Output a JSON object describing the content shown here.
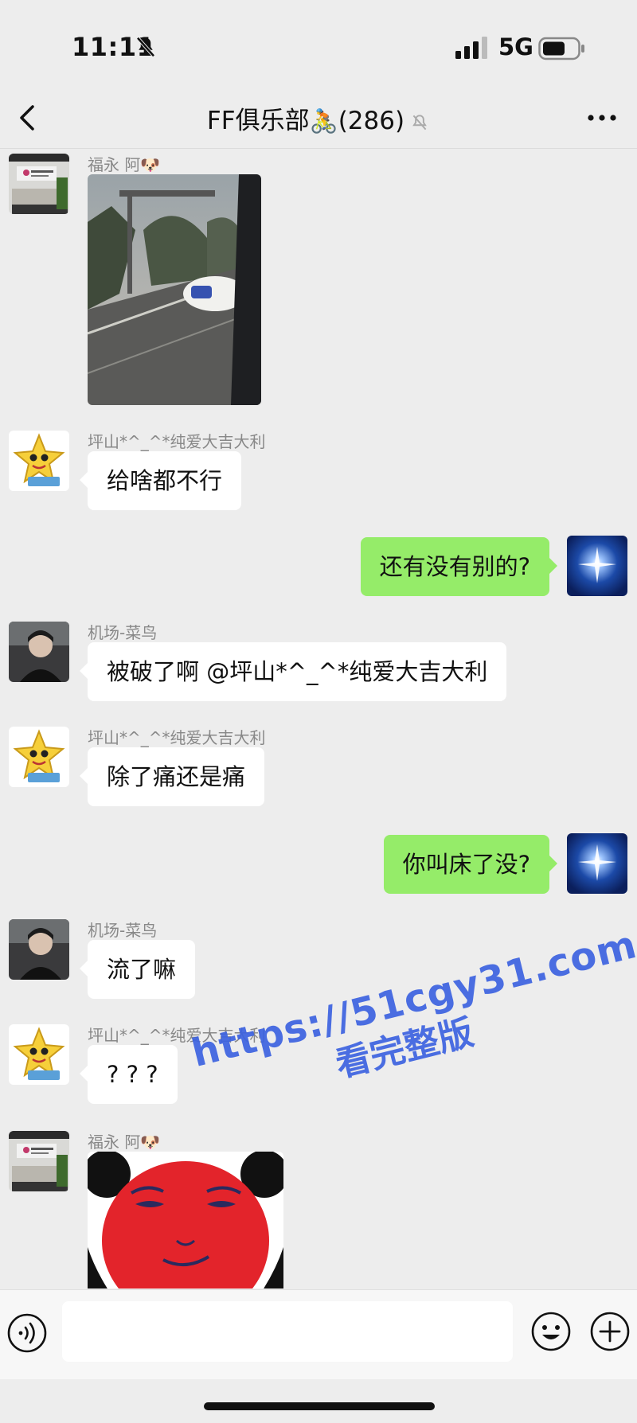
{
  "status_bar": {
    "time": "11:11",
    "network": "5G"
  },
  "header": {
    "title": "FF俱乐部",
    "title_emoji": "🚴",
    "member_count": "(286)"
  },
  "messages": [
    {
      "sender": "福永 阿🐶",
      "type": "image"
    },
    {
      "sender": "坪山*^_^*纯爱大吉大利",
      "text": "给啥都不行"
    },
    {
      "sender": "",
      "text": "还有没有别的?",
      "mine": true
    },
    {
      "sender": "机场-菜鸟",
      "text": "被破了啊 @坪山*^_^*纯爱大吉大利"
    },
    {
      "sender": "坪山*^_^*纯爱大吉大利",
      "text": "除了痛还是痛"
    },
    {
      "sender": "",
      "text": "你叫床了没?",
      "mine": true
    },
    {
      "sender": "机场-菜鸟",
      "text": "流了嘛"
    },
    {
      "sender": "坪山*^_^*纯爱大吉大利",
      "text": "? ? ?"
    },
    {
      "sender": "福永 阿🐶",
      "type": "sticker"
    }
  ],
  "watermark": {
    "url": "https://51cgy31.com",
    "subtitle": "看完整版"
  },
  "composer": {
    "placeholder": ""
  },
  "colors": {
    "background": "#ededed",
    "my_bubble": "#95ec69",
    "watermark": "#3d63e0"
  }
}
